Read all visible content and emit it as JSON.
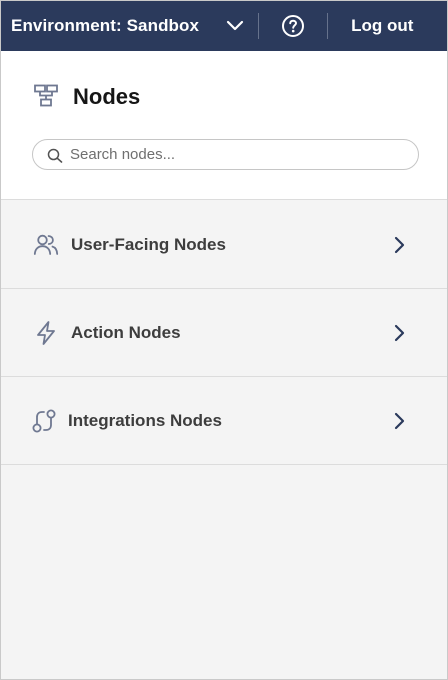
{
  "topbar": {
    "environment_label": "Environment: Sandbox",
    "environment_dropdown_icon": "chevron-down-icon",
    "help_icon": "help-circle-icon",
    "logout_label": "Log out",
    "background_color": "#2b3a5c"
  },
  "panel": {
    "title": "Nodes",
    "title_icon": "hierarchy-icon",
    "search": {
      "placeholder": "Search nodes...",
      "value": "",
      "icon": "search-icon"
    }
  },
  "categories": [
    {
      "label": "User-Facing Nodes",
      "icon": "users-icon",
      "chevron": "chevron-right-icon"
    },
    {
      "label": "Action Nodes",
      "icon": "lightning-icon",
      "chevron": "chevron-right-icon"
    },
    {
      "label": "Integrations Nodes",
      "icon": "integration-icon",
      "chevron": "chevron-right-icon"
    }
  ]
}
